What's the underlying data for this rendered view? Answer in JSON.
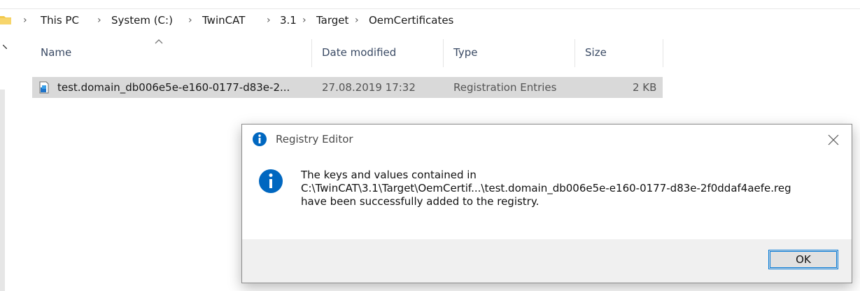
{
  "breadcrumb": {
    "items": [
      "This PC",
      "System (C:)",
      "TwinCAT",
      "3.1",
      "Target",
      "OemCertificates"
    ],
    "separator": "›"
  },
  "columns": {
    "name": "Name",
    "date_modified": "Date modified",
    "type": "Type",
    "size": "Size"
  },
  "files": [
    {
      "name": "test.domain_db006e5e-e160-0177-d83e-2...",
      "date_modified": "27.08.2019 17:32",
      "type": "Registration Entries",
      "size": "2 KB",
      "icon": "reg-file-icon"
    }
  ],
  "dialog": {
    "title": "Registry Editor",
    "message_lines": [
      "The keys and values contained in",
      "C:\\TwinCAT\\3.1\\Target\\OemCertif...\\test.domain_db006e5e-e160-0177-d83e-2f0ddaf4aefe.reg",
      "have been successfully added to the registry."
    ],
    "ok_label": "OK",
    "close_glyph": "✕",
    "icon": "info-icon"
  },
  "colors": {
    "info_blue": "#0067c0",
    "selection_gray": "#d9d9d9",
    "button_focus": "#0078d7",
    "folder_yellow": "#f2c94c"
  }
}
